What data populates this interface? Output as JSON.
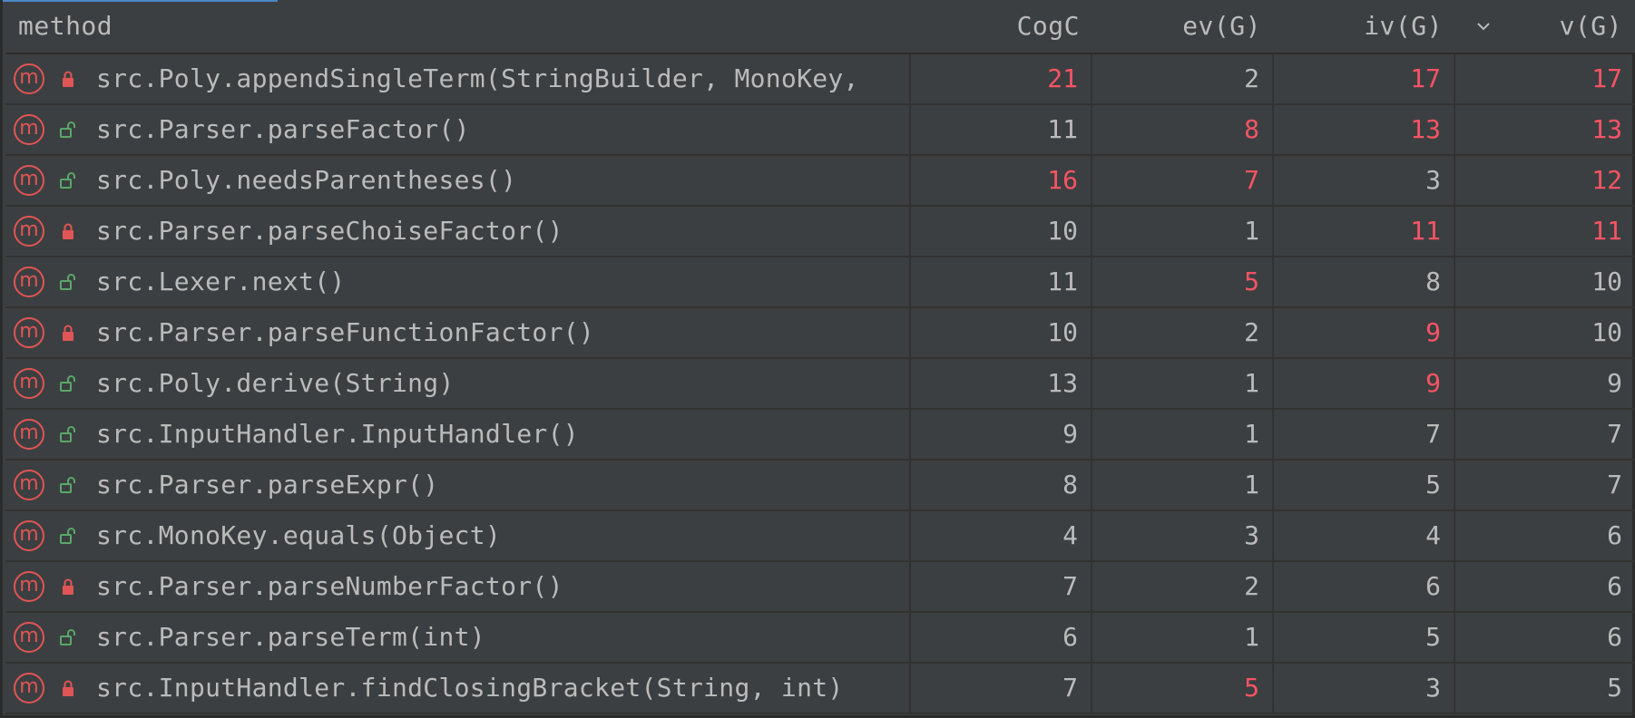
{
  "table": {
    "columns": {
      "method": "method",
      "cogc": "CogC",
      "evg": "ev(G)",
      "ivg": "iv(G)",
      "vg": "v(G)"
    },
    "sorted_column": "v(G)",
    "sort_direction": "descending",
    "rows": [
      {
        "access": "private",
        "name": "src.Poly.appendSingleTerm(StringBuilder, MonoKey, ",
        "cogc": "21",
        "evg": "2",
        "ivg": "17",
        "vg": "17",
        "hot": [
          true,
          false,
          true,
          true
        ]
      },
      {
        "access": "public",
        "name": "src.Parser.parseFactor()",
        "cogc": "11",
        "evg": "8",
        "ivg": "13",
        "vg": "13",
        "hot": [
          false,
          true,
          true,
          true
        ]
      },
      {
        "access": "public",
        "name": "src.Poly.needsParentheses()",
        "cogc": "16",
        "evg": "7",
        "ivg": "3",
        "vg": "12",
        "hot": [
          true,
          true,
          false,
          true
        ]
      },
      {
        "access": "private",
        "name": "src.Parser.parseChoiseFactor()",
        "cogc": "10",
        "evg": "1",
        "ivg": "11",
        "vg": "11",
        "hot": [
          false,
          false,
          true,
          true
        ]
      },
      {
        "access": "public",
        "name": "src.Lexer.next()",
        "cogc": "11",
        "evg": "5",
        "ivg": "8",
        "vg": "10",
        "hot": [
          false,
          true,
          false,
          false
        ]
      },
      {
        "access": "private",
        "name": "src.Parser.parseFunctionFactor()",
        "cogc": "10",
        "evg": "2",
        "ivg": "9",
        "vg": "10",
        "hot": [
          false,
          false,
          true,
          false
        ]
      },
      {
        "access": "public",
        "name": "src.Poly.derive(String)",
        "cogc": "13",
        "evg": "1",
        "ivg": "9",
        "vg": "9",
        "hot": [
          false,
          false,
          true,
          false
        ]
      },
      {
        "access": "public",
        "name": "src.InputHandler.InputHandler()",
        "cogc": "9",
        "evg": "1",
        "ivg": "7",
        "vg": "7",
        "hot": [
          false,
          false,
          false,
          false
        ]
      },
      {
        "access": "public",
        "name": "src.Parser.parseExpr()",
        "cogc": "8",
        "evg": "1",
        "ivg": "5",
        "vg": "7",
        "hot": [
          false,
          false,
          false,
          false
        ]
      },
      {
        "access": "public",
        "name": "src.MonoKey.equals(Object)",
        "cogc": "4",
        "evg": "3",
        "ivg": "4",
        "vg": "6",
        "hot": [
          false,
          false,
          false,
          false
        ]
      },
      {
        "access": "private",
        "name": "src.Parser.parseNumberFactor()",
        "cogc": "7",
        "evg": "2",
        "ivg": "6",
        "vg": "6",
        "hot": [
          false,
          false,
          false,
          false
        ]
      },
      {
        "access": "public",
        "name": "src.Parser.parseTerm(int)",
        "cogc": "6",
        "evg": "1",
        "ivg": "5",
        "vg": "6",
        "hot": [
          false,
          false,
          false,
          false
        ]
      },
      {
        "access": "private",
        "name": "src.InputHandler.findClosingBracket(String, int)",
        "cogc": "7",
        "evg": "5",
        "ivg": "3",
        "vg": "5",
        "hot": [
          false,
          true,
          false,
          false
        ]
      }
    ]
  },
  "icons": {
    "method": "method-icon",
    "private": "lock-closed-icon",
    "public": "lock-open-icon",
    "sort": "chevron-down-icon"
  },
  "colors": {
    "background": "#3c3f41",
    "text": "#bbbbbb",
    "hot": "#f75464",
    "method_icon": "#e05555",
    "private_lock": "#e05555",
    "public_lock": "#59a869",
    "accent": "#4a88c7"
  }
}
